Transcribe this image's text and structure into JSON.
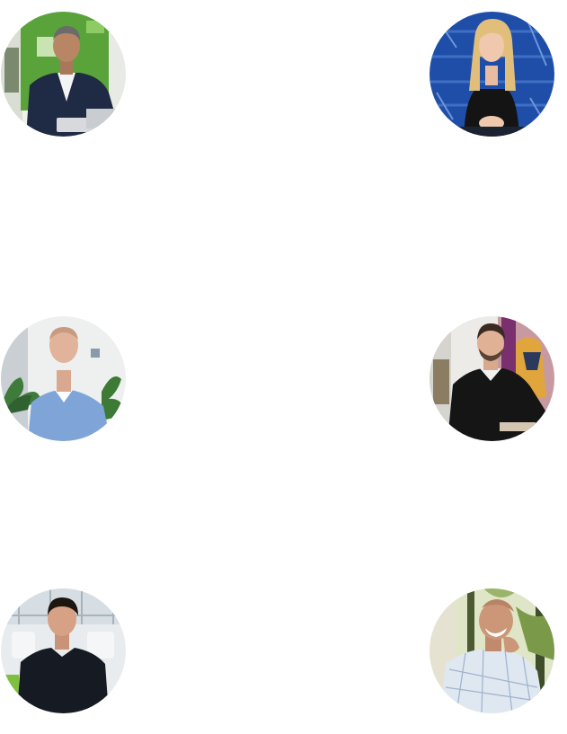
{
  "team": {
    "members": [
      {
        "photo": "portrait-man-navy-suit-green-wall"
      },
      {
        "photo": "portrait-woman-blonde-blue-wall"
      },
      {
        "photo": "portrait-man-blue-sweater-plants"
      },
      {
        "photo": "portrait-man-black-sweater-art-wall"
      },
      {
        "photo": "portrait-man-black-sweater-office"
      },
      {
        "photo": "portrait-man-checked-shirt-forest-wall"
      }
    ]
  }
}
